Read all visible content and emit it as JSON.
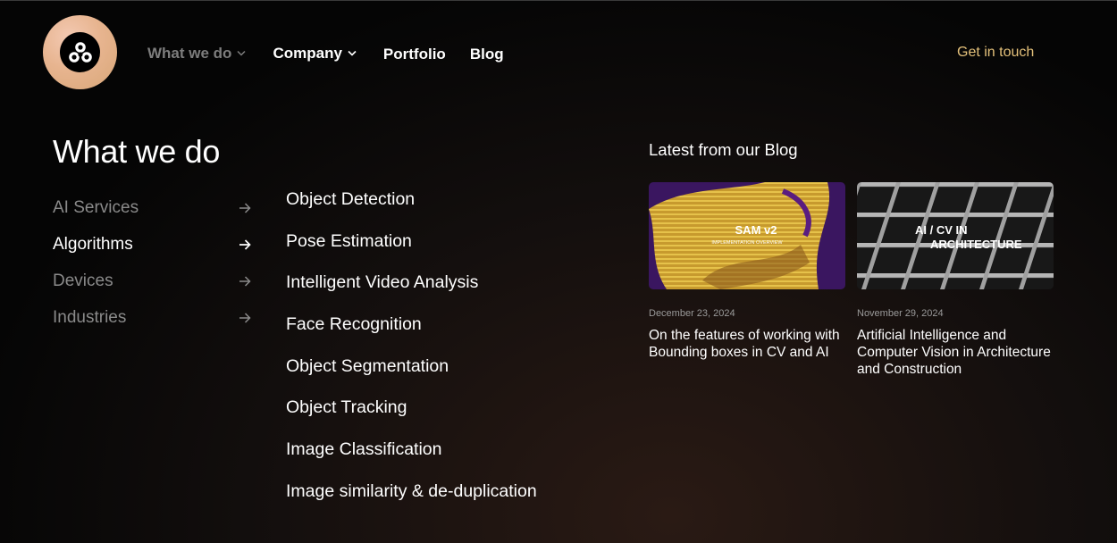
{
  "header": {
    "logo_icon": "trefoil-logo-icon",
    "nav": [
      {
        "label": "What we do",
        "has_dropdown": true,
        "active": false
      },
      {
        "label": "Company",
        "has_dropdown": true,
        "active": true
      },
      {
        "label": "Portfolio",
        "has_dropdown": false
      },
      {
        "label": "Blog",
        "has_dropdown": false
      }
    ],
    "cta_label": "Get in touch",
    "cta_color": "#e3c07a"
  },
  "menu": {
    "title": "What we do",
    "categories": [
      {
        "label": "AI Services",
        "active": false
      },
      {
        "label": "Algorithms",
        "active": true
      },
      {
        "label": "Devices",
        "active": false
      },
      {
        "label": "Industries",
        "active": false
      }
    ],
    "items": [
      "Object Detection",
      "Pose Estimation",
      "Intelligent Video Analysis",
      "Face Recognition",
      "Object Segmentation",
      "Object Tracking",
      "Image Classification",
      "Image similarity & de-duplication"
    ]
  },
  "blog": {
    "heading": "Latest from our Blog",
    "posts": [
      {
        "date": "December 23, 2024",
        "title": "On the features of working with Bounding boxes in CV and AI",
        "thumb_caption": "SAM v2",
        "thumb_subcaption": "IMPLEMENTATION OVERVIEW"
      },
      {
        "date": "November 29, 2024",
        "title": "Artificial Intelligence and Computer Vision in Architecture and Construction",
        "thumb_caption": "AI / CV  IN",
        "thumb_subcaption": "ARCHITECTURE"
      }
    ]
  }
}
